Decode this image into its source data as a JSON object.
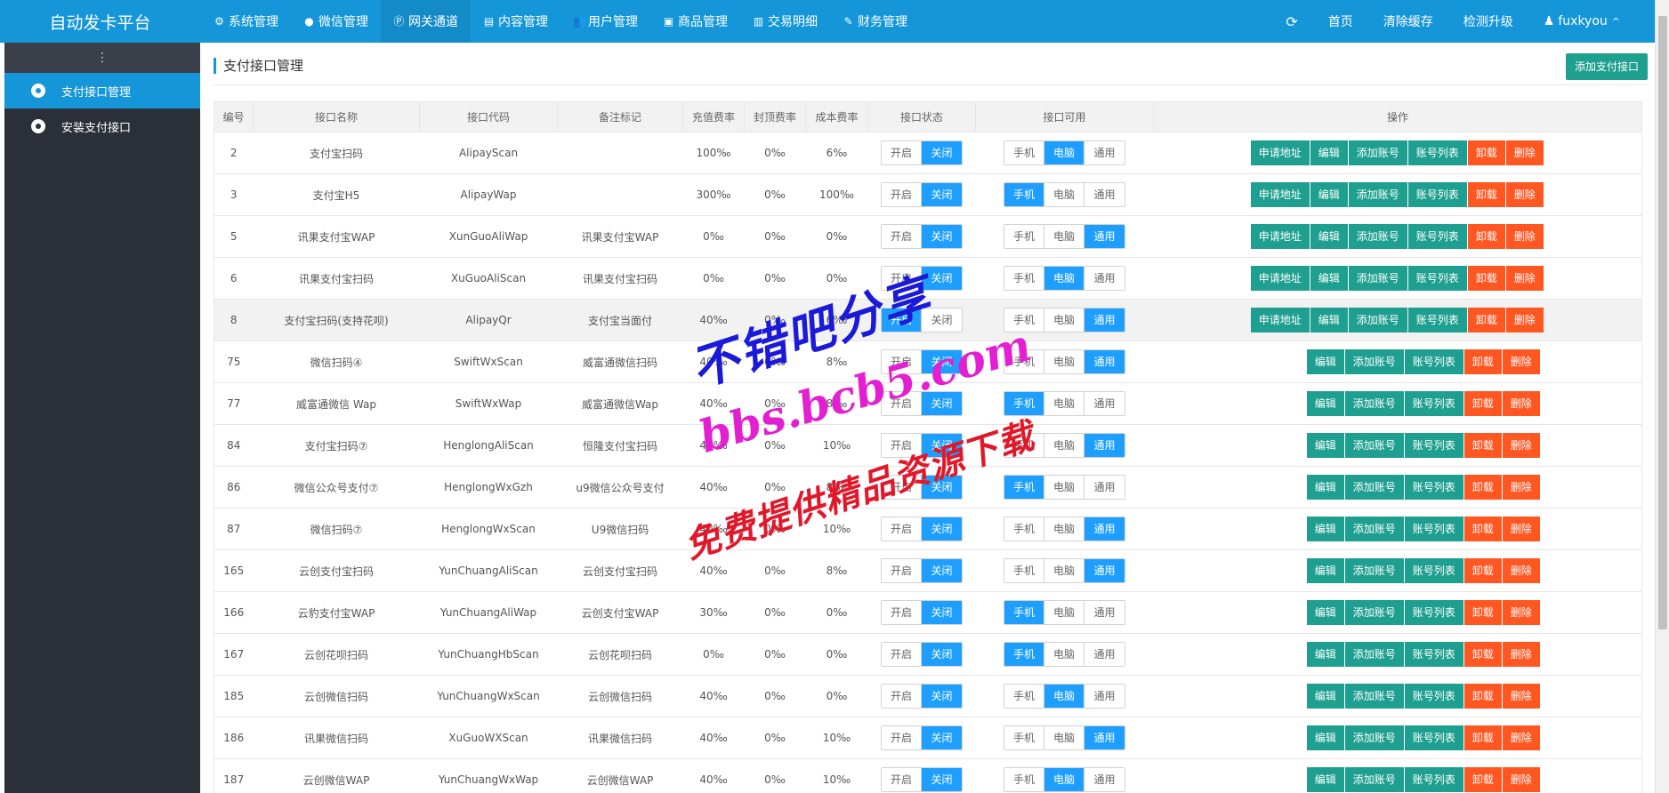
{
  "brand": "自动发卡平台",
  "topnav": [
    {
      "label": "系统管理",
      "icon": "gear-icon",
      "glyph": "⚙"
    },
    {
      "label": "微信管理",
      "icon": "wechat-icon",
      "glyph": "●"
    },
    {
      "label": "网关通道",
      "icon": "gateway-icon",
      "glyph": "Ⓟ",
      "active": true
    },
    {
      "label": "内容管理",
      "icon": "file-icon",
      "glyph": "▤"
    },
    {
      "label": "用户管理",
      "icon": "users-icon",
      "glyph": "👥"
    },
    {
      "label": "商品管理",
      "icon": "bag-icon",
      "glyph": "▣"
    },
    {
      "label": "交易明细",
      "icon": "bar-chart-icon",
      "glyph": "▥"
    },
    {
      "label": "财务管理",
      "icon": "finance-icon",
      "glyph": "✎"
    }
  ],
  "topright": {
    "refresh_glyph": "⟳",
    "home": "首页",
    "clear_cache": "清除缓存",
    "upgrade": "检测升级",
    "user": "fuxkyou",
    "caret": "^"
  },
  "sidebar": {
    "toggle_glyph": "⋮",
    "items": [
      {
        "label": "支付接口管理",
        "active": true
      },
      {
        "label": "安装支付接口",
        "active": false
      }
    ]
  },
  "page": {
    "title": "支付接口管理",
    "add_button": "添加支付接口"
  },
  "table": {
    "headers": [
      "编号",
      "接口名称",
      "接口代码",
      "备注标记",
      "充值费率",
      "封顶费率",
      "成本费率",
      "接口状态",
      "接口可用",
      "操作"
    ],
    "status_labels": [
      "开启",
      "关闭"
    ],
    "device_labels": [
      "手机",
      "电脑",
      "通用"
    ],
    "op_labels": {
      "apply": "申请地址",
      "edit": "编辑",
      "add_account": "添加账号",
      "account_list": "账号列表",
      "uninstall": "卸载",
      "delete": "删除"
    },
    "rows": [
      {
        "id": "2",
        "name": "支付宝扫码",
        "code": "AlipayScan",
        "remark": "",
        "rate": "100‰",
        "cap": "0‰",
        "cost": "6‰",
        "status": 1,
        "device": 1,
        "apply": true
      },
      {
        "id": "3",
        "name": "支付宝H5",
        "code": "AlipayWap",
        "remark": "",
        "rate": "300‰",
        "cap": "0‰",
        "cost": "100‰",
        "status": 1,
        "device": 0,
        "apply": true
      },
      {
        "id": "5",
        "name": "讯果支付宝WAP",
        "code": "XunGuoAliWap",
        "remark": "讯果支付宝WAP",
        "rate": "0‰",
        "cap": "0‰",
        "cost": "0‰",
        "status": 1,
        "device": 2,
        "apply": true
      },
      {
        "id": "6",
        "name": "讯果支付宝扫码",
        "code": "XuGuoAliScan",
        "remark": "讯果支付宝扫码",
        "rate": "0‰",
        "cap": "0‰",
        "cost": "0‰",
        "status": 1,
        "device": 1,
        "apply": true
      },
      {
        "id": "8",
        "name": "支付宝扫码(支持花呗)",
        "code": "AlipayQr",
        "remark": "支付宝当面付",
        "rate": "40‰",
        "cap": "0‰",
        "cost": "6‰",
        "status": 0,
        "device": 2,
        "apply": true,
        "highlight": true
      },
      {
        "id": "75",
        "name": "微信扫码④",
        "code": "SwiftWxScan",
        "remark": "威富通微信扫码",
        "rate": "40‰",
        "cap": "0‰",
        "cost": "8‰",
        "status": 1,
        "device": 2,
        "apply": false
      },
      {
        "id": "77",
        "name": "威富通微信 Wap",
        "code": "SwiftWxWap",
        "remark": "威富通微信Wap",
        "rate": "40‰",
        "cap": "0‰",
        "cost": "8‰",
        "status": 1,
        "device": 0,
        "apply": false
      },
      {
        "id": "84",
        "name": "支付宝扫码⑦",
        "code": "HenglongAliScan",
        "remark": "恒隆支付宝扫码",
        "rate": "40‰",
        "cap": "0‰",
        "cost": "10‰",
        "status": 1,
        "device": 2,
        "apply": false
      },
      {
        "id": "86",
        "name": "微信公众号支付⑦",
        "code": "HenglongWxGzh",
        "remark": "u9微信公众号支付",
        "rate": "40‰",
        "cap": "0‰",
        "cost": "8‰",
        "status": 1,
        "device": 0,
        "apply": false
      },
      {
        "id": "87",
        "name": "微信扫码⑦",
        "code": "HenglongWxScan",
        "remark": "U9微信扫码",
        "rate": "40‰",
        "cap": "0‰",
        "cost": "10‰",
        "status": 1,
        "device": 2,
        "apply": false
      },
      {
        "id": "165",
        "name": "云创支付宝扫码",
        "code": "YunChuangAliScan",
        "remark": "云创支付宝扫码",
        "rate": "40‰",
        "cap": "0‰",
        "cost": "8‰",
        "status": 1,
        "device": 2,
        "apply": false
      },
      {
        "id": "166",
        "name": "云豹支付宝WAP",
        "code": "YunChuangAliWap",
        "remark": "云创支付宝WAP",
        "rate": "30‰",
        "cap": "0‰",
        "cost": "0‰",
        "status": 1,
        "device": 0,
        "apply": false
      },
      {
        "id": "167",
        "name": "云创花呗扫码",
        "code": "YunChuangHbScan",
        "remark": "云创花呗扫码",
        "rate": "0‰",
        "cap": "0‰",
        "cost": "0‰",
        "status": 1,
        "device": 0,
        "apply": false
      },
      {
        "id": "185",
        "name": "云创微信扫码",
        "code": "YunChuangWxScan",
        "remark": "云创微信扫码",
        "rate": "40‰",
        "cap": "0‰",
        "cost": "0‰",
        "status": 1,
        "device": 1,
        "apply": false
      },
      {
        "id": "186",
        "name": "讯果微信扫码",
        "code": "XuGuoWXScan",
        "remark": "讯果微信扫码",
        "rate": "40‰",
        "cap": "0‰",
        "cost": "10‰",
        "status": 1,
        "device": 2,
        "apply": false
      },
      {
        "id": "187",
        "name": "云创微信WAP",
        "code": "YunChuangWxWap",
        "remark": "云创微信WAP",
        "rate": "40‰",
        "cap": "0‰",
        "cost": "10‰",
        "status": 1,
        "device": 1,
        "apply": false
      }
    ]
  },
  "watermark": {
    "line1": "不错吧分享",
    "line2": "bbs.bcb5.com",
    "line3": "免费提供精品资源下载"
  },
  "colors": {
    "primary": "#1596d8",
    "sidebar": "#2b2f38",
    "toggle_on": "#1e9fff",
    "op_green": "#1e9f8f",
    "op_orange": "#ff5722"
  }
}
